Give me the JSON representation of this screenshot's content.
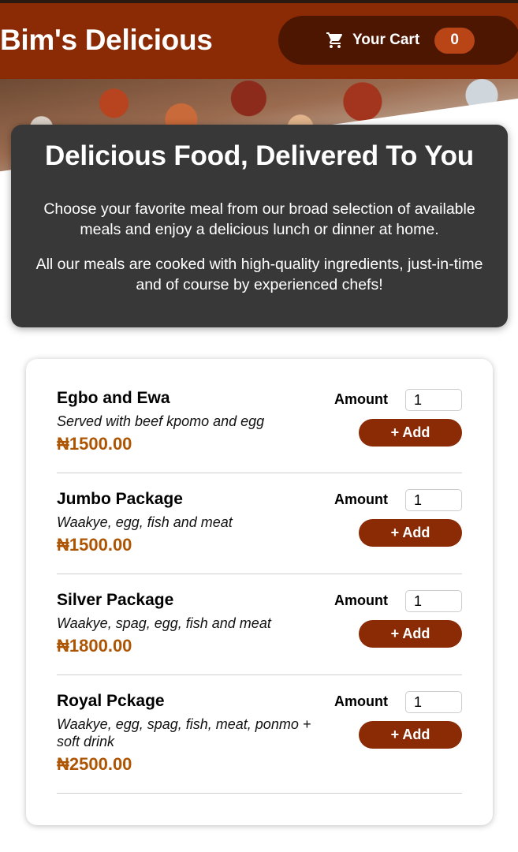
{
  "header": {
    "brand": "Bim's Delicious",
    "cart_label": "Your Cart",
    "cart_count": "0",
    "cart_icon": "shopping-cart-icon"
  },
  "summary": {
    "title": "Delicious Food, Delivered To You",
    "paragraph1": "Choose your favorite meal from our broad selection of available meals and enjoy a delicious lunch or dinner at home.",
    "paragraph2": "All our meals are cooked with high-quality ingredients, just-in-time and of course by experienced chefs!"
  },
  "meals": [
    {
      "name": "Egbo and Ewa",
      "description": "Served with beef kpomo and egg",
      "price": "₦1500.00",
      "amount_label": "Amount",
      "amount_value": "1",
      "add_label": "+ Add"
    },
    {
      "name": "Jumbo Package",
      "description": "Waakye, egg, fish and meat",
      "price": "₦1500.00",
      "amount_label": "Amount",
      "amount_value": "1",
      "add_label": "+ Add"
    },
    {
      "name": "Silver Package",
      "description": "Waakye, spag, egg, fish and meat",
      "price": "₦1800.00",
      "amount_label": "Amount",
      "amount_value": "1",
      "add_label": "+ Add"
    },
    {
      "name": "Royal Pckage",
      "description": "Waakye, egg, spag, fish, meat, ponmo + soft drink",
      "price": "₦2500.00",
      "amount_label": "Amount",
      "amount_value": "1",
      "add_label": "+ Add"
    }
  ],
  "colors": {
    "header": "#8a2b06",
    "cart_button": "#4d1601",
    "cart_badge": "#b94517",
    "summary_bg": "#383838",
    "price": "#ad5502"
  }
}
